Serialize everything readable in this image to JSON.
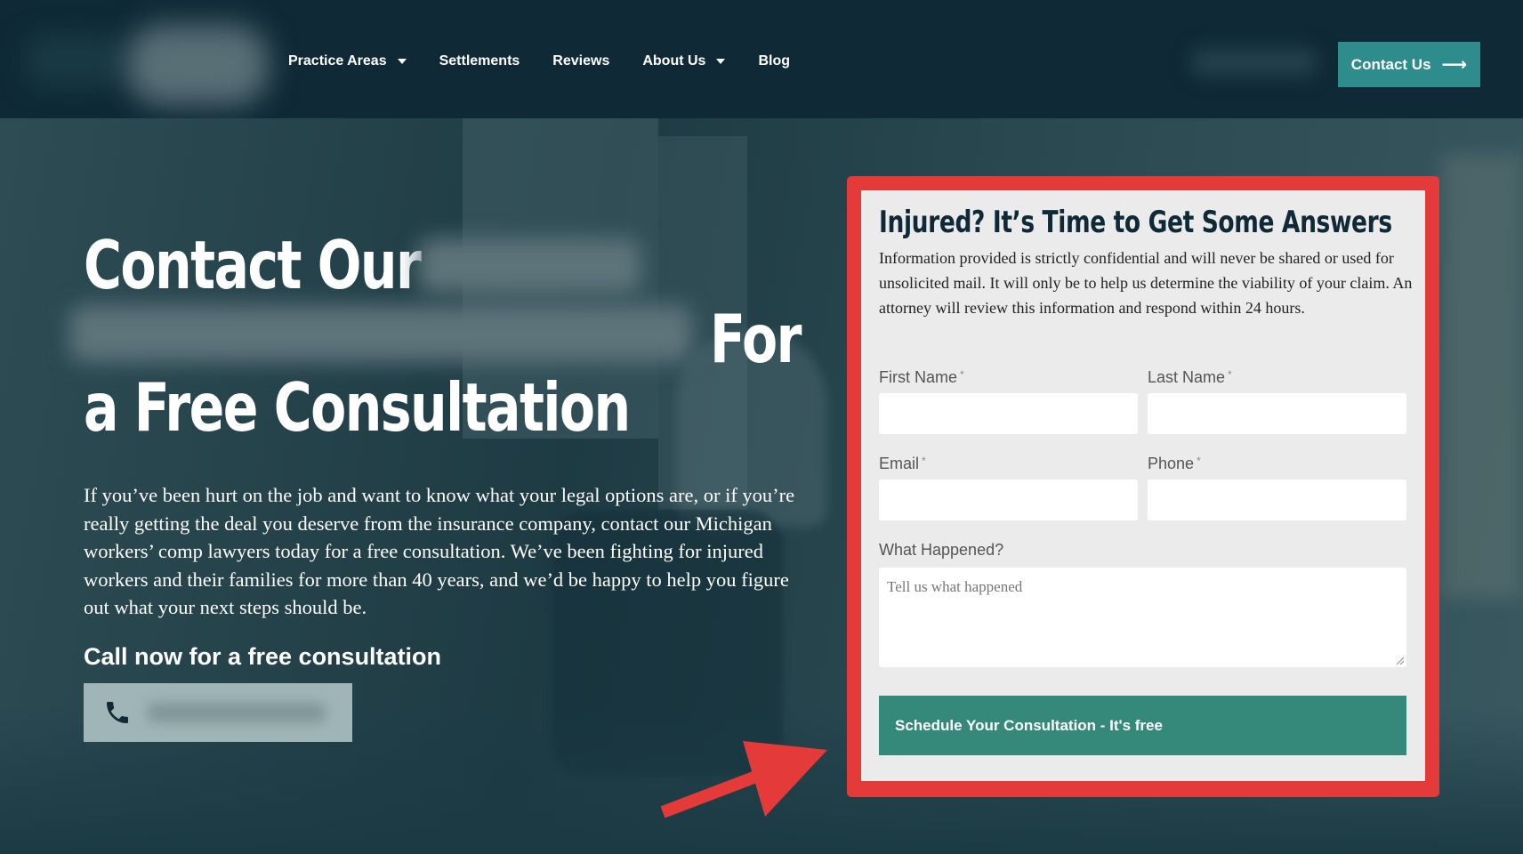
{
  "nav": {
    "items": [
      {
        "label": "Practice Areas",
        "has_dropdown": true
      },
      {
        "label": "Settlements",
        "has_dropdown": false
      },
      {
        "label": "Reviews",
        "has_dropdown": false
      },
      {
        "label": "About Us",
        "has_dropdown": true
      },
      {
        "label": "Blog",
        "has_dropdown": false
      }
    ],
    "contact_button": {
      "label": "Contact Us",
      "icon": "arrow-right-icon"
    }
  },
  "hero": {
    "heading_line1": "Contact Our",
    "heading_line2_end": "For",
    "heading_line3": "a Free Consultation",
    "intro": "If you’ve been hurt on the job and want to know what your legal options are, or if you’re really getting the deal you deserve from the insurance company, contact our Michigan workers’ comp lawyers today for a free consultation. We’ve been fighting for injured workers and their families for more than 40 years, and we’d be happy to help you figure out what your next steps should be.",
    "call_label": "Call now for a free consultation",
    "phone_icon": "phone-icon"
  },
  "form": {
    "title": "Injured? It’s Time to Get Some Answers",
    "description": "Information provided is strictly confidential and will never be shared or used for unsolicited mail. It will only be to help us determine the viability of your claim. An attorney will review this information and respond within 24 hours.",
    "required_marker": "*",
    "fields": {
      "first_name": {
        "label": "First Name",
        "value": ""
      },
      "last_name": {
        "label": "Last Name",
        "value": ""
      },
      "email": {
        "label": "Email",
        "value": ""
      },
      "phone": {
        "label": "Phone",
        "value": ""
      },
      "what_happened": {
        "label": "What Happened?",
        "placeholder": "Tell us what happened",
        "value": ""
      }
    },
    "submit_label": "Schedule Your Consultation - It's free"
  },
  "colors": {
    "header_bg": "#0f2a36",
    "accent_teal": "#2f8c8d",
    "submit_green": "#34897a",
    "highlight_red": "#e43a39"
  }
}
